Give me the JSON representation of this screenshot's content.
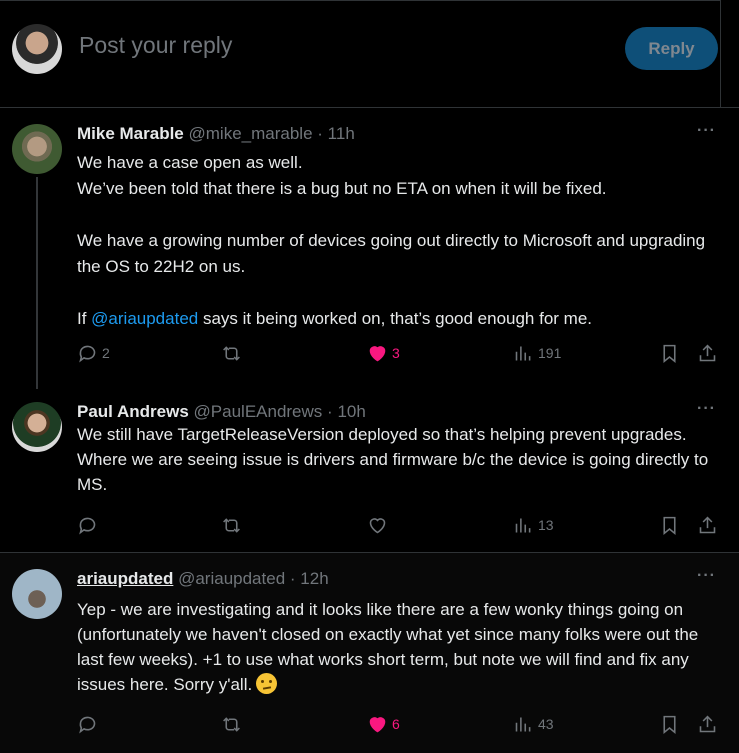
{
  "composer": {
    "placeholder": "Post your reply",
    "reply_label": "Reply"
  },
  "tweets": [
    {
      "name": "Mike Marable",
      "handle": "@mike_marable",
      "separator": "·",
      "time": "11h",
      "paragraphs": [
        "We have a case open as well.",
        "We’ve been told that there is a bug but no ETA on when it will be fixed.",
        "We have a growing number of devices going out directly to Microsoft and upgrading the OS to 22H2 on us.",
        "says it being worked on, that’s good enough for me."
      ],
      "para4_prefix": "If ",
      "mention": "@ariaupdated",
      "replies": "2",
      "likes": "3",
      "views": "191"
    },
    {
      "name": "Paul Andrews",
      "handle": "@PaulEAndrews",
      "separator": "·",
      "time": "10h",
      "text": "We still have TargetReleaseVersion deployed so that’s helping prevent upgrades. Where we are seeing issue is drivers and firmware b/c the device is going directly to MS.",
      "views": "13"
    },
    {
      "name": "ariaupdated",
      "handle": "@ariaupdated",
      "separator": "·",
      "time": "12h",
      "text": "Yep - we are investigating and it looks like there are a few wonky things going on (unfortunately we haven't closed on exactly what yet since many folks were out the last few weeks). +1 to use what works short term, but note we will find and fix any issues here. Sorry y'all.",
      "likes": "6",
      "views": "43"
    }
  ],
  "icons": [
    "reply-icon",
    "retweet-icon",
    "like-icon",
    "views-icon",
    "bookmark-icon",
    "share-icon",
    "more-icon",
    "confused-emoji"
  ],
  "colors": {
    "background": "#000000",
    "text": "#e7e9ea",
    "muted": "#71767b",
    "accent": "#1d9bf0",
    "like": "#f91880",
    "reply_button": "#0e4f78"
  }
}
